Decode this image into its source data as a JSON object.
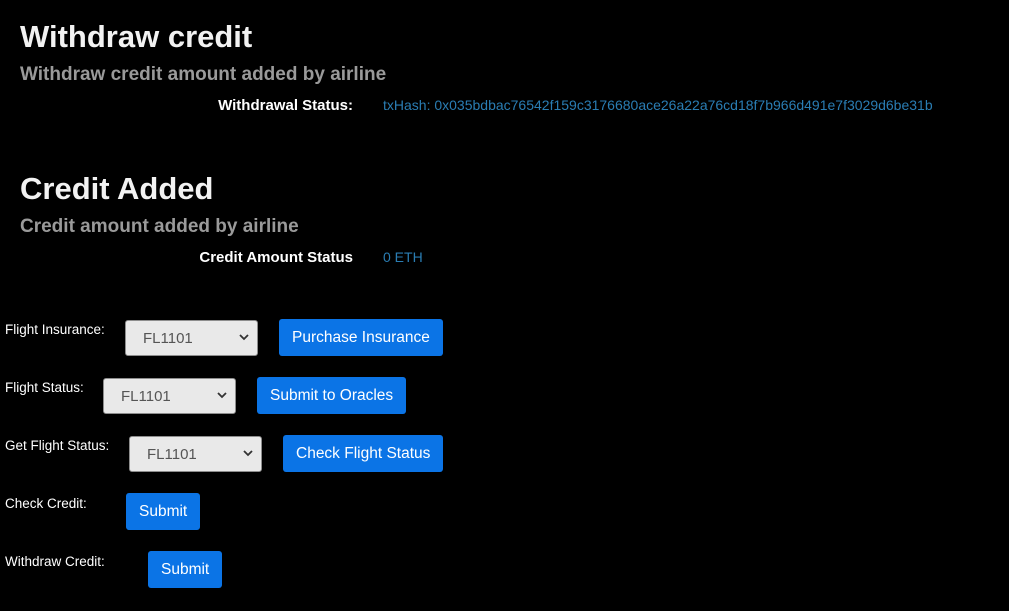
{
  "withdraw_section": {
    "title": "Withdraw credit",
    "subtitle": "Withdraw credit amount added by airline",
    "status_label": "Withdrawal Status:",
    "status_value": "txHash: 0x035bdbac76542f159c3176680ace26a22a76cd18f7b966d491e7f3029d6be31b"
  },
  "credit_section": {
    "title": "Credit Added",
    "subtitle": "Credit amount added by airline",
    "status_label": "Credit Amount Status",
    "status_value": "0 ETH"
  },
  "forms": {
    "flight_insurance": {
      "label": "Flight Insurance:",
      "selected": "FL1101",
      "button": "Purchase Insurance"
    },
    "flight_status": {
      "label": "Flight Status:",
      "selected": "FL1101",
      "button": "Submit to Oracles"
    },
    "get_flight_status": {
      "label": "Get Flight Status:",
      "selected": "FL1101",
      "button": "Check Flight Status"
    },
    "check_credit": {
      "label": "Check Credit:",
      "button": "Submit"
    },
    "withdraw_credit": {
      "label": "Withdraw Credit:",
      "button": "Submit"
    }
  },
  "icons": {
    "select_arrow": "chevron-down-icon"
  },
  "colors": {
    "background": "#000000",
    "button": "#0b74e6",
    "status_value": "#2a7db3",
    "subtitle": "#9a9a9a"
  }
}
